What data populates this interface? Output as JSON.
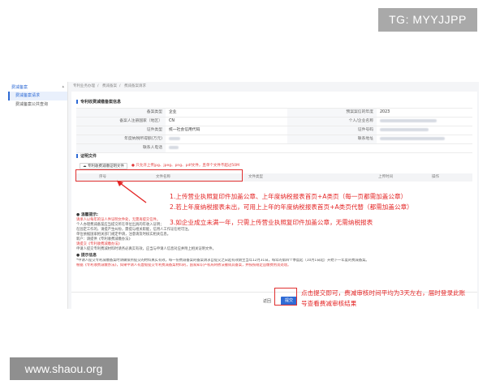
{
  "watermark_top": "TG: MYYJJPP",
  "watermark_bottom": "www.shaou.org",
  "sidebar": {
    "header": "费减备案",
    "items": [
      {
        "label": "费减备案请求",
        "active": true
      },
      {
        "label": "费减备案公共查询",
        "active": false
      }
    ]
  },
  "breadcrumbs": [
    "专利业务办理",
    "费减备案",
    "费减备案请求"
  ],
  "section_info_title": "专利收费减缴备案信息",
  "info_rows": [
    {
      "label": "备案类型",
      "value": "企业",
      "label2": "预案案信的年度",
      "value2": "2023"
    },
    {
      "label": "备案人注册国家（地区）",
      "value": "CN",
      "label2": "个人/企业名称",
      "value2": ""
    },
    {
      "label": "证件类型",
      "value": "统一社会信用代码",
      "label2": "证件号码",
      "value2": ""
    },
    {
      "label": "年度纳税所得额(万元)",
      "value": "",
      "label2": "联系地址",
      "value2": ""
    },
    {
      "label": "联系人电话",
      "value": "",
      "label2": "",
      "value2": ""
    }
  ],
  "section_docs_title": "证明文件",
  "upload_button": "专利收费减缴证明文件",
  "upload_tip": "只允许上传jpg、jpeg、png、pdf文件，且单个文件不超过50M",
  "table_headers": [
    "序号",
    "文件名称",
    "文件类型",
    "上传时间",
    "操作"
  ],
  "notice_title": "温馨提示:",
  "notice_lines": [
    "请承人以每年的证人件证明文件处，无需再提交信件。",
    "个人办理费减备案应当提交所在单位出具的年收入证明；",
    "在固定工作的，请提产生纠纷，需提与相关职能，信用人工作证在经可注。",
    "单位依据国家相关部门规定申请，注意请及时核实相关信息。",
    "新户：请提供《专利收费减缴办法》"
  ],
  "notice_link": "请提交《专利收费减缴办法》",
  "notice_footer": "申请人提交专利费减材料时请务必真实有效，应当与申请人信息对应并附上相关证明文件。",
  "tips_title": "提示信息",
  "tips_line1": "*申请人提交专利减缴备案时请确保所提交的材料真实有效，每一份费减备案的备案请求自提交之日起有效期至当年12月31日，每年的第四个季度起（10月1日起）开始下一年度的费减备案。",
  "tips_line2": "根据《专利收费减缴办法》，如果申请人有虚假提交专利费减备案材料的，国家知识产权局将依法撤销其备案，并按照规定追缴费用及处理。",
  "back_button": "返回",
  "submit_button": "提交",
  "annotations": {
    "line1": "1.上传营业执照复印件加盖公章、上年度纳税报表首页+A类页（每一页都需加盖公章）",
    "line2": "2.若上年度纳税报表未出，可用上上年的年度纳税报表首页+A类页代替（都需加盖公章）",
    "line3": "3.如企业成立未满一年，只需上传营业执照复印件加盖公章，无需纳税报表",
    "line4": "点击提交即可，费减审核时间平均为3天左右，届时登录此账",
    "line5": "号查看费减审核结果"
  },
  "colors": {
    "accent": "#2f6bd5",
    "annotation_red": "#e42525",
    "watermark_gray": "#a9a9a9"
  }
}
